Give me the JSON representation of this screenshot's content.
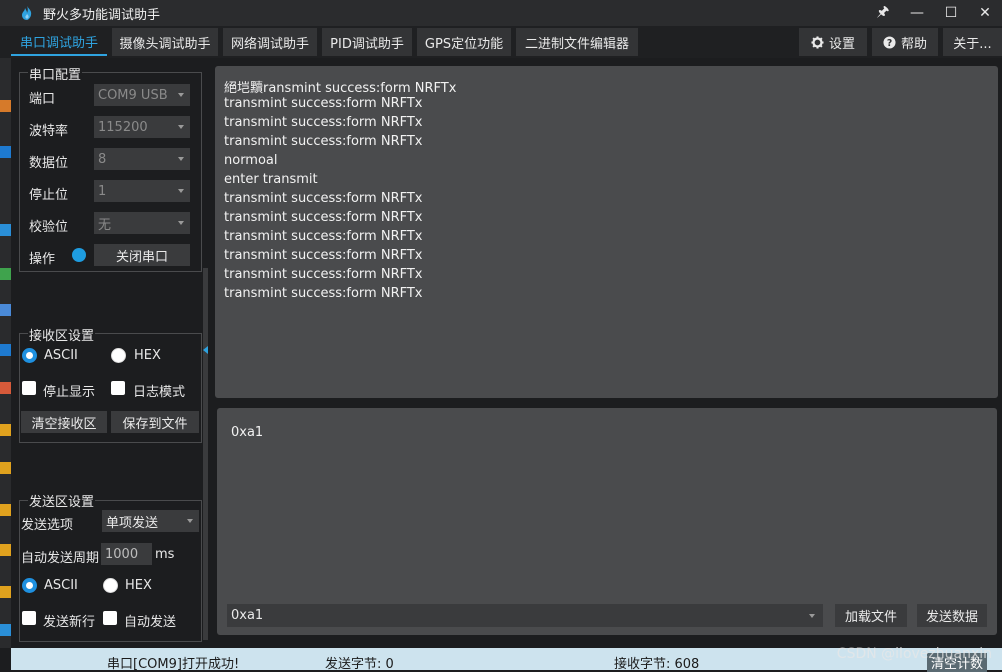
{
  "app": {
    "title": "野火多功能调试助手"
  },
  "window_controls": {
    "pin": "🖈",
    "minimize": "—",
    "maximize": "☐",
    "close": "✕"
  },
  "tabs": [
    {
      "label": "串口调试助手"
    },
    {
      "label": "摄像头调试助手"
    },
    {
      "label": "网络调试助手"
    },
    {
      "label": "PID调试助手"
    },
    {
      "label": "GPS定位功能"
    },
    {
      "label": "二进制文件编辑器"
    }
  ],
  "top_buttons": {
    "settings": "设置",
    "help": "帮助",
    "about": "关于..."
  },
  "serial_config": {
    "title": "串口配置",
    "port_label": "端口",
    "port_value": "COM9 USB",
    "baud_label": "波特率",
    "baud_value": "115200",
    "databits_label": "数据位",
    "databits_value": "8",
    "stopbits_label": "停止位",
    "stopbits_value": "1",
    "parity_label": "校验位",
    "parity_value": "无",
    "operation_label": "操作",
    "close_port_button": "关闭串口"
  },
  "receive_settings": {
    "title": "接收区设置",
    "ascii_label": "ASCII",
    "hex_label": "HEX",
    "stop_display_label": "停止显示",
    "log_mode_label": "日志模式",
    "clear_button": "清空接收区",
    "save_button": "保存到文件"
  },
  "send_settings": {
    "title": "发送区设置",
    "option_label": "发送选项",
    "option_value": "单项发送",
    "period_label": "自动发送周期",
    "period_value": "1000",
    "period_unit": "ms",
    "ascii_label": "ASCII",
    "hex_label": "HEX",
    "newline_label": "发送新行",
    "auto_send_label": "自动发送"
  },
  "receive_area": {
    "lines": [
      "絕垲黷ransmint success:form NRFTx",
      "transmint success:form NRFTx",
      "transmint success:form NRFTx",
      "transmint success:form NRFTx",
      "normoal",
      "enter transmit",
      "transmint success:form NRFTx",
      "transmint success:form NRFTx",
      "transmint success:form NRFTx",
      "transmint success:form NRFTx",
      "transmint success:form NRFTx",
      "transmint success:form NRFTx"
    ]
  },
  "send_area": {
    "text": "0xa1",
    "history_value": "0xa1",
    "load_file_button": "加载文件",
    "send_button": "发送数据"
  },
  "status": {
    "message": "串口[COM9]打开成功!",
    "sent_bytes": "发送字节: 0",
    "received_bytes": "接收字节: 608",
    "clear_count": "清空计数"
  },
  "watermark": "CSDN @ilovezhuanxin",
  "colors": {
    "accent": "#2fa3e0",
    "status_dot": "#1e9ce0"
  }
}
